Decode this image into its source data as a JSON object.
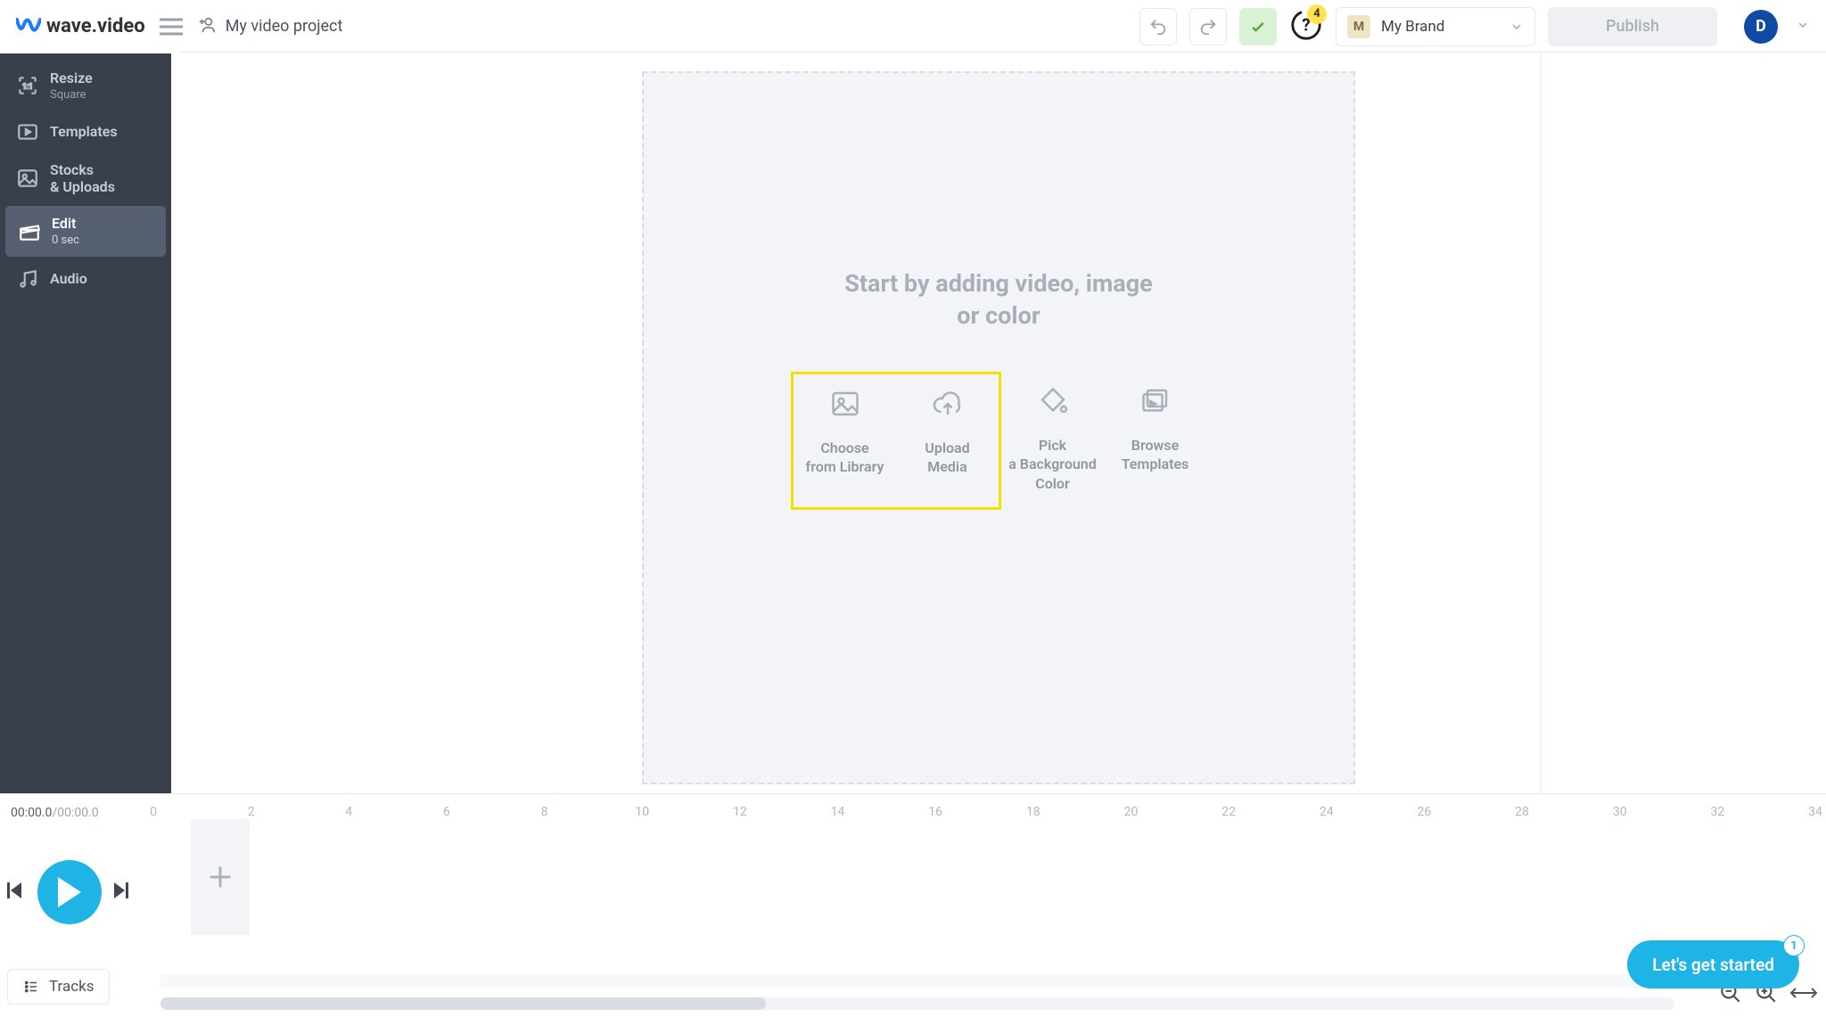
{
  "header": {
    "logo_text": "wave.video",
    "project_title": "My video project",
    "help_badge": "4",
    "brand_chip": "M",
    "brand_label": "My Brand",
    "publish_label": "Publish",
    "avatar_letter": "D"
  },
  "sidebar": {
    "items": [
      {
        "title": "Resize",
        "sub": "Square"
      },
      {
        "title": "Templates",
        "sub": ""
      },
      {
        "title": "Stocks\n& Uploads",
        "sub": ""
      },
      {
        "title": "Edit",
        "sub": "0 sec"
      },
      {
        "title": "Audio",
        "sub": ""
      }
    ]
  },
  "canvas": {
    "heading_l1": "Start by adding video, image",
    "heading_l2": "or color",
    "tiles": [
      {
        "label_l1": "Choose",
        "label_l2": "from Library"
      },
      {
        "label_l1": "Upload",
        "label_l2": "Media"
      },
      {
        "label_l1": "Pick",
        "label_l2": "a Background",
        "label_l3": "Color"
      },
      {
        "label_l1": "Browse",
        "label_l2": "Templates"
      }
    ]
  },
  "timeline": {
    "current_time": "00:00.0",
    "total_time": "00:00.0",
    "ticks": [
      "0",
      "2",
      "4",
      "6",
      "8",
      "10",
      "12",
      "14",
      "16",
      "18",
      "20",
      "22",
      "24",
      "26",
      "28",
      "30",
      "32",
      "34"
    ],
    "tracks_label": "Tracks"
  },
  "chat": {
    "label": "Let's get started",
    "badge": "1"
  }
}
